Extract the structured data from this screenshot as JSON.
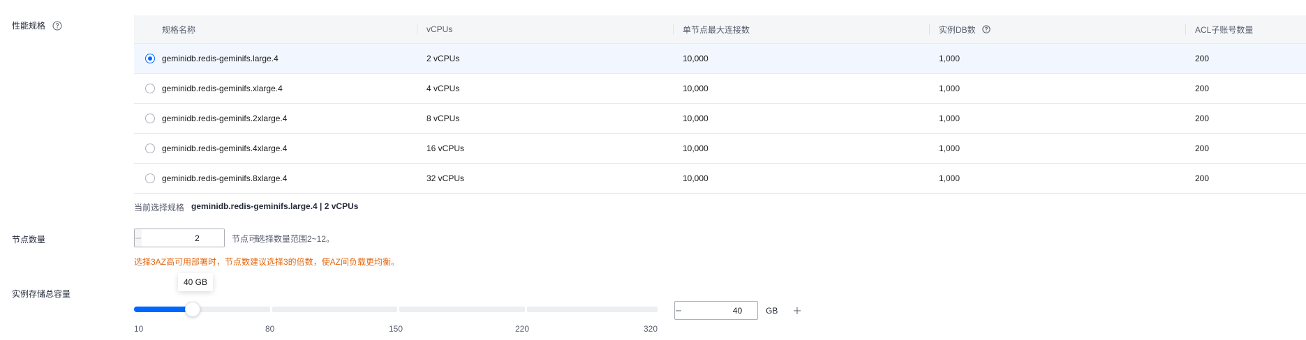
{
  "labels": {
    "performance_spec": "性能规格",
    "node_count": "节点数量",
    "storage_total": "实例存储总容量"
  },
  "table": {
    "headers": [
      "规格名称",
      "vCPUs",
      "单节点最大连接数",
      "实例DB数",
      "ACL子账号数量"
    ],
    "rows": [
      {
        "name": "geminidb.redis-geminifs.large.4",
        "vcpus": "2 vCPUs",
        "max_conn": "10,000",
        "db_count": "1,000",
        "acl": "200",
        "selected": true
      },
      {
        "name": "geminidb.redis-geminifs.xlarge.4",
        "vcpus": "4 vCPUs",
        "max_conn": "10,000",
        "db_count": "1,000",
        "acl": "200",
        "selected": false
      },
      {
        "name": "geminidb.redis-geminifs.2xlarge.4",
        "vcpus": "8 vCPUs",
        "max_conn": "10,000",
        "db_count": "1,000",
        "acl": "200",
        "selected": false
      },
      {
        "name": "geminidb.redis-geminifs.4xlarge.4",
        "vcpus": "16 vCPUs",
        "max_conn": "10,000",
        "db_count": "1,000",
        "acl": "200",
        "selected": false
      },
      {
        "name": "geminidb.redis-geminifs.8xlarge.4",
        "vcpus": "32 vCPUs",
        "max_conn": "10,000",
        "db_count": "1,000",
        "acl": "200",
        "selected": false
      }
    ]
  },
  "current_selection": {
    "label": "当前选择规格",
    "value": "geminidb.redis-geminifs.large.4 | 2 vCPUs"
  },
  "node_stepper": {
    "value": "2",
    "hint": "节点可选择数量范围2~12。",
    "warning": "选择3AZ高可用部署时，节点数建议选择3的倍数，使AZ间负载更均衡。"
  },
  "storage": {
    "tooltip": "40 GB",
    "value": "40",
    "unit": "GB",
    "min": 10,
    "max": 320,
    "current": 40,
    "ticks": [
      "10",
      "80",
      "150",
      "220",
      "320"
    ]
  },
  "colors": {
    "accent": "#0066ff",
    "warning": "#e26711",
    "selected_row": "#f2f7ff",
    "header_bg": "#f4f6f8"
  },
  "icons": {
    "help": "question-circle-icon",
    "minus": "minus-icon",
    "plus": "plus-icon"
  }
}
